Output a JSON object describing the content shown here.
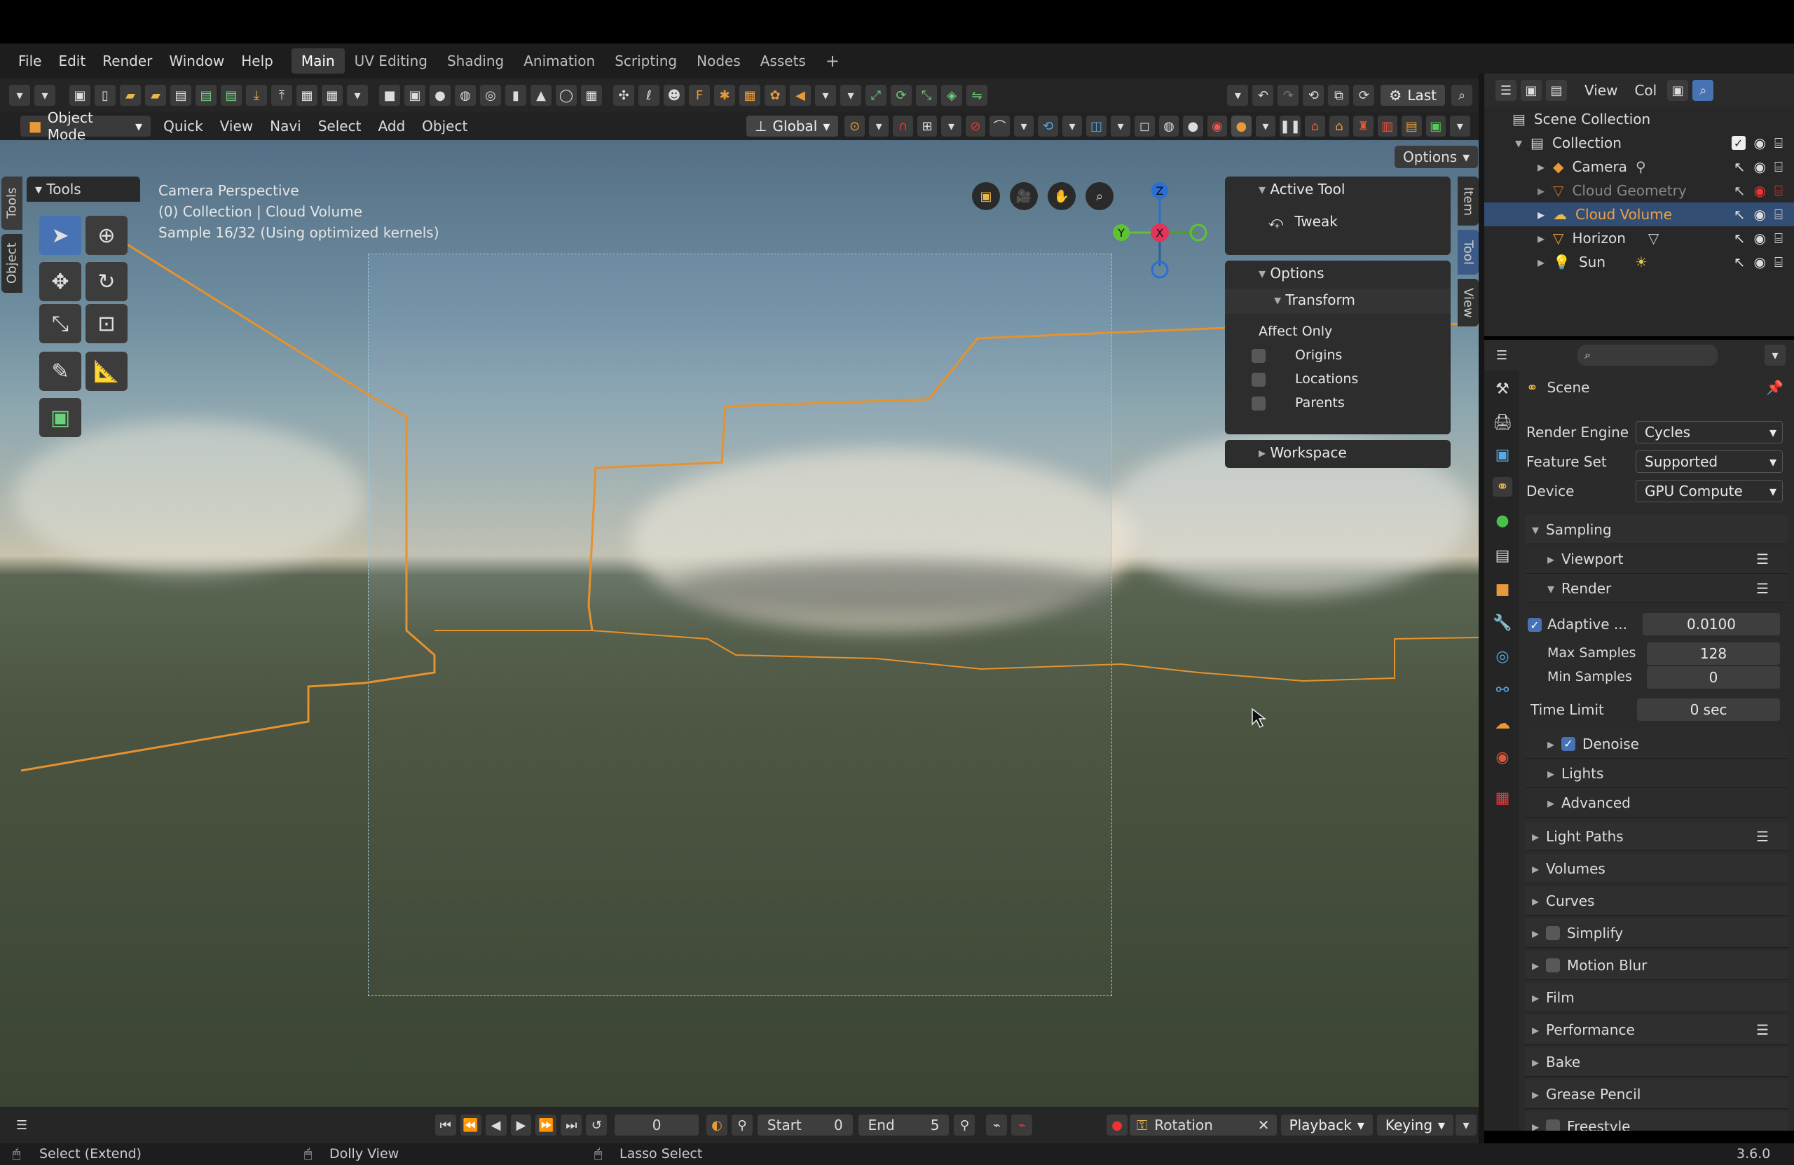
{
  "menu": [
    "File",
    "Edit",
    "Render",
    "Window",
    "Help"
  ],
  "workspaces": [
    "Main",
    "UV Editing",
    "Shading",
    "Animation",
    "Scripting",
    "Nodes",
    "Assets"
  ],
  "active_workspace": "Main",
  "header": {
    "mode": "Object Mode",
    "menus": [
      "Quick",
      "View",
      "Navi",
      "Select",
      "Add",
      "Object"
    ],
    "orientation": "Global",
    "last": "Last",
    "options": "Options"
  },
  "viewport": {
    "info": [
      "Camera Perspective",
      "(0) Collection | Cloud Volume",
      "Sample 16/32 (Using optimized kernels)"
    ]
  },
  "left_tabs": [
    "Tools",
    "Object"
  ],
  "tools_panel": {
    "title": "Tools"
  },
  "npanel": {
    "active_tool": "Active Tool",
    "tool": "Tweak",
    "options": "Options",
    "transform": "Transform",
    "affect_only": "Affect Only",
    "affect": [
      {
        "label": "Origins",
        "checked": false
      },
      {
        "label": "Locations",
        "checked": false
      },
      {
        "label": "Parents",
        "checked": false
      }
    ],
    "workspace": "Workspace"
  },
  "right_tabs": [
    "Item",
    "Tool",
    "View"
  ],
  "gizmo": {
    "z": "Z",
    "y": "Y",
    "x": "X"
  },
  "outliner": {
    "header": [
      "View",
      "Col"
    ],
    "scene": "Scene Collection",
    "collection": "Collection",
    "items": [
      {
        "name": "Camera"
      },
      {
        "name": "Cloud Geometry"
      },
      {
        "name": "Cloud Volume"
      },
      {
        "name": "Horizon"
      },
      {
        "name": "Sun"
      }
    ]
  },
  "props": {
    "context": "Scene",
    "render_engine_label": "Render Engine",
    "render_engine": "Cycles",
    "feature_set_label": "Feature Set",
    "feature_set": "Supported",
    "device_label": "Device",
    "device": "GPU Compute",
    "sampling": "Sampling",
    "viewport": "Viewport",
    "render": "Render",
    "adaptive_label": "Adaptive ...",
    "adaptive_value": "0.0100",
    "max_samples_label": "Max Samples",
    "max_samples": "128",
    "min_samples_label": "Min Samples",
    "min_samples": "0",
    "time_limit_label": "Time Limit",
    "time_limit": "0 sec",
    "denoise": "Denoise",
    "lights": "Lights",
    "advanced": "Advanced",
    "sections": [
      {
        "label": "Light Paths"
      },
      {
        "label": "Volumes"
      },
      {
        "label": "Curves"
      },
      {
        "label": "Simplify"
      },
      {
        "label": "Motion Blur"
      },
      {
        "label": "Film"
      },
      {
        "label": "Performance"
      },
      {
        "label": "Bake"
      },
      {
        "label": "Grease Pencil"
      },
      {
        "label": "Freestyle"
      }
    ]
  },
  "timeline": {
    "frame": "0",
    "start_label": "Start",
    "start": "0",
    "end_label": "End",
    "end": "5",
    "keying_set": "Rotation",
    "playback": "Playback",
    "keying": "Keying"
  },
  "status": {
    "select": "Select (Extend)",
    "dolly": "Dolly View",
    "lasso": "Lasso Select",
    "version": "3.6.0"
  }
}
